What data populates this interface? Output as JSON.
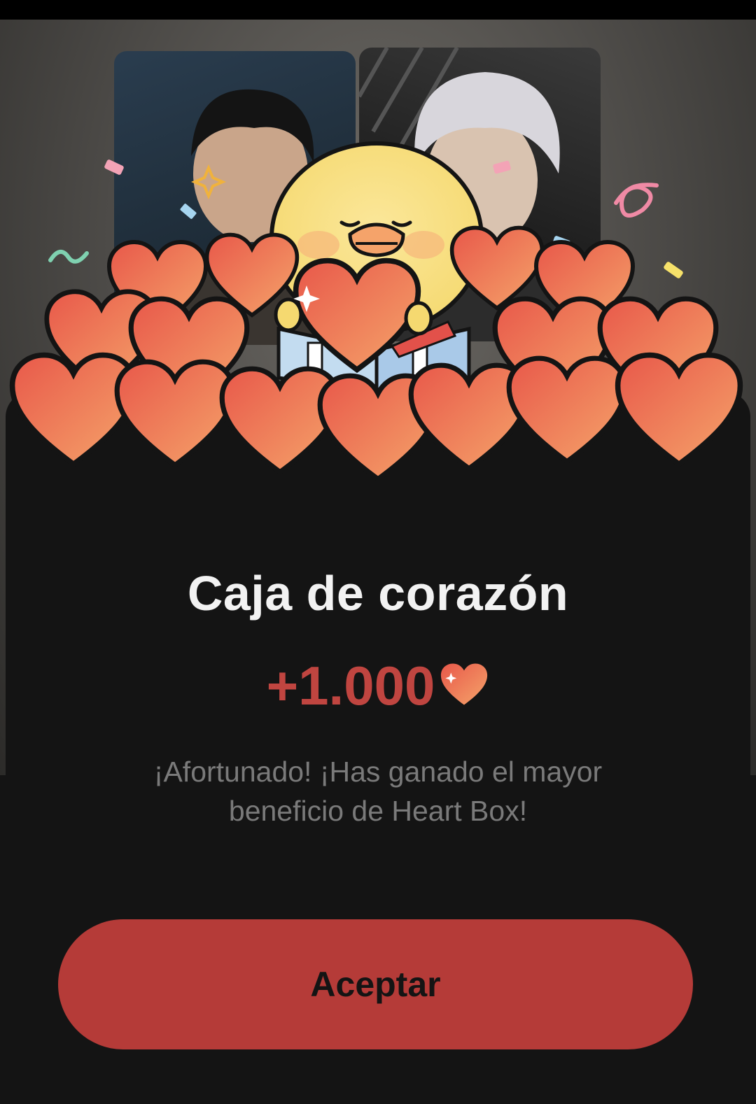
{
  "dialog": {
    "title": "Caja de corazón",
    "amount": "+1.000",
    "amount_icon": "heart-icon",
    "message": "¡Afortunado! ¡Has ganado el mayor beneficio de Heart Box!",
    "accept_label": "Aceptar"
  },
  "colors": {
    "accent": "#b53b38",
    "amount_text": "#c04540",
    "background": "#141414",
    "heart_light": "#f5a46a",
    "heart_dark": "#e8584a"
  },
  "illustration": {
    "character": "chick-holding-heart",
    "decorations": [
      "confetti",
      "hearts-pile",
      "gift-box"
    ]
  }
}
